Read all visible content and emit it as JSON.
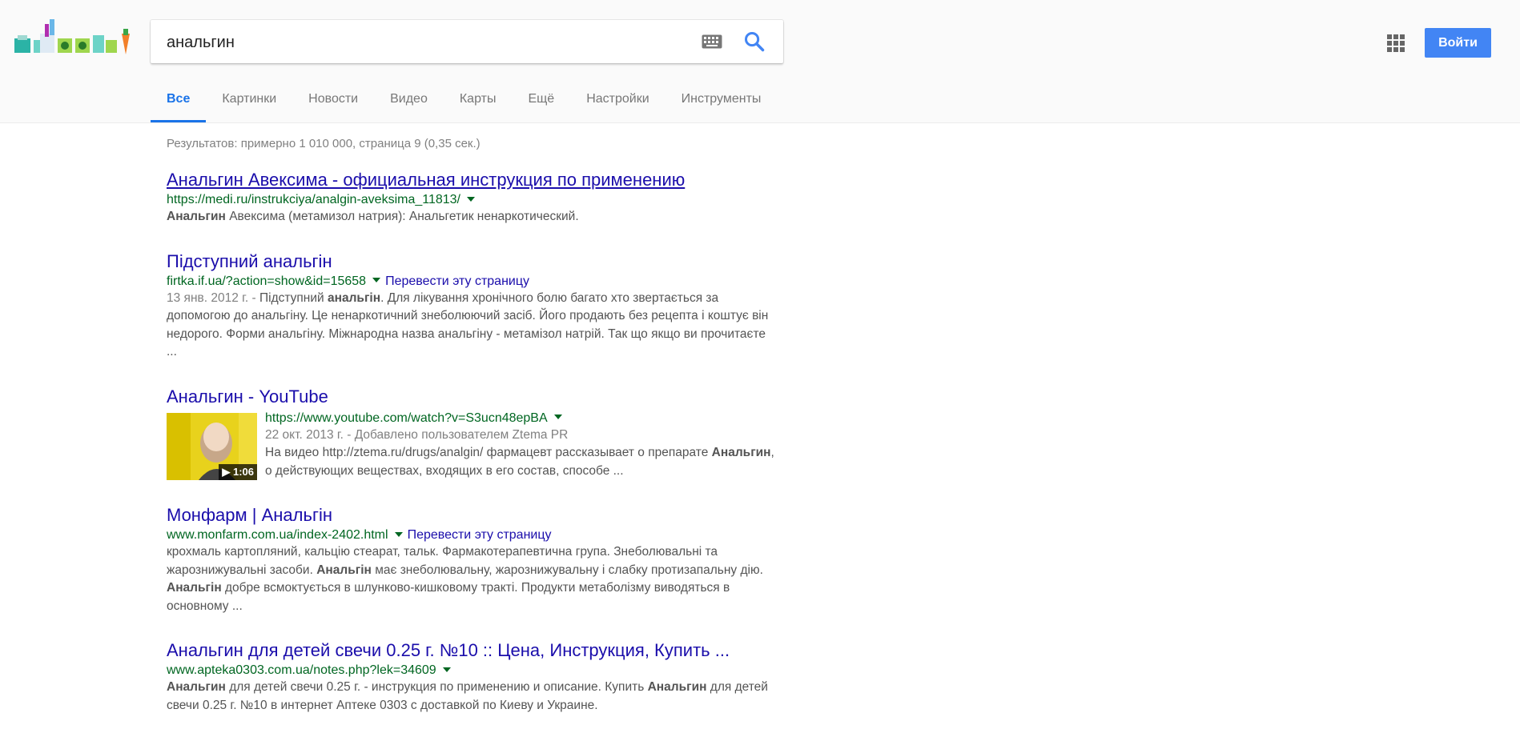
{
  "search": {
    "query": "анальгин"
  },
  "header": {
    "login_label": "Войти"
  },
  "tabs": [
    "Все",
    "Картинки",
    "Новости",
    "Видео",
    "Карты",
    "Ещё",
    "Настройки",
    "Инструменты"
  ],
  "stats": "Результатов: примерно 1 010 000, страница 9 (0,35 сек.)",
  "results": [
    {
      "title": "Анальгин Авексима - официальная инструкция по применению",
      "url": "https://medi.ru/instrukciya/analgin-aveksima_11813/",
      "snippet_b1": "Анальгин",
      "snippet_t1": " Авексима (метамизол натрия): Анальгетик ненаркотический."
    },
    {
      "title": "Підступний анальгін",
      "url": "firtka.if.ua/?action=show&id=15658",
      "translate": "Перевести эту страницу",
      "date": "13 янв. 2012 г. - ",
      "snippet_t1": "Підступний ",
      "snippet_b1": "анальгін",
      "snippet_t2": ". Для лікування хронічного болю багато хто звертається за допомогою до анальгіну. Це ненаркотичний знеболюючий засіб. Його продають без рецепта і коштує він недорого. Форми анальгіну. Міжнародна назва анальгіну - метамізол натрій. Так що якщо ви прочитаєте ..."
    },
    {
      "title": "Анальгин - YouTube",
      "url": "https://www.youtube.com/watch?v=S3ucn48epBA",
      "date": "22 окт. 2013 г. - Добавлено пользователем Ztema PR",
      "duration": "▶ 1:06",
      "snippet_t1": "На видео http://ztema.ru/drugs/analgin/ фармацевт рассказывает о препарате ",
      "snippet_b1": "Анальгин",
      "snippet_t2": ", о действующих веществах, входящих в его состав, способе ..."
    },
    {
      "title": "Монфарм | Анальгін",
      "url": "www.monfarm.com.ua/index-2402.html",
      "translate": "Перевести эту страницу",
      "snippet_t1": "крохмаль картопляний, кальцію стеарат, тальк. Фармакотерапевтична група. Знеболювальні та жарознижувальні засоби. ",
      "snippet_b1": "Анальгін",
      "snippet_t2": " має знеболювальну, жарознижувальну і слабку протизапальну дію. ",
      "snippet_b2": "Анальгін",
      "snippet_t3": " добре всмоктується в шлунково-кишковому тракті. Продукти метаболізму виводяться в основному ..."
    },
    {
      "title": "Анальгин для детей свечи 0.25 г. №10 :: Цена, Инструкция, Купить ...",
      "url": "www.apteka0303.com.ua/notes.php?lek=34609",
      "snippet_b1": "Анальгин",
      "snippet_t1": " для детей свечи 0.25 г. - инструкция по применению и описание. Купить ",
      "snippet_b2": "Анальгин",
      "snippet_t2": " для детей свечи 0.25 г. №10 в интернет Аптеке 0303 с доставкой по Киеву и Украине."
    }
  ]
}
